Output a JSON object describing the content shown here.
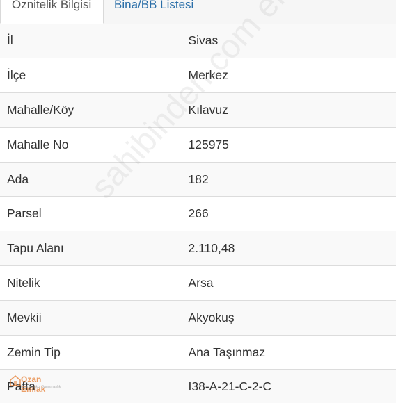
{
  "tabs": [
    {
      "label": "Öznitelik Bilgisi",
      "active": true
    },
    {
      "label": "Bina/BB Listesi",
      "active": false
    }
  ],
  "rows": [
    {
      "key": "İl",
      "value": "Sivas"
    },
    {
      "key": "İlçe",
      "value": "Merkez"
    },
    {
      "key": "Mahalle/Köy",
      "value": "Kılavuz"
    },
    {
      "key": "Mahalle No",
      "value": "125975"
    },
    {
      "key": "Ada",
      "value": "182"
    },
    {
      "key": "Parsel",
      "value": "266"
    },
    {
      "key": "Tapu Alanı",
      "value": "2.110,48"
    },
    {
      "key": "Nitelik",
      "value": "Arsa"
    },
    {
      "key": "Mevkii",
      "value": "Akyokuş"
    },
    {
      "key": "Zemin Tip",
      "value": "Ana Taşınmaz"
    },
    {
      "key": "Pafta",
      "value": "I38-A-21-C-2-C"
    }
  ],
  "watermark": {
    "text": "sahibinden.com emlakjet.com"
  },
  "logo": {
    "name": "Ozan Emlak",
    "tagline": "Gayrimenkul Danışmanlık"
  },
  "colors": {
    "tab_link": "#2a6ea8",
    "text": "#333333",
    "border": "#dcdcdc",
    "row_alt": "#f9f9f9",
    "logo_accent": "#e67828"
  }
}
